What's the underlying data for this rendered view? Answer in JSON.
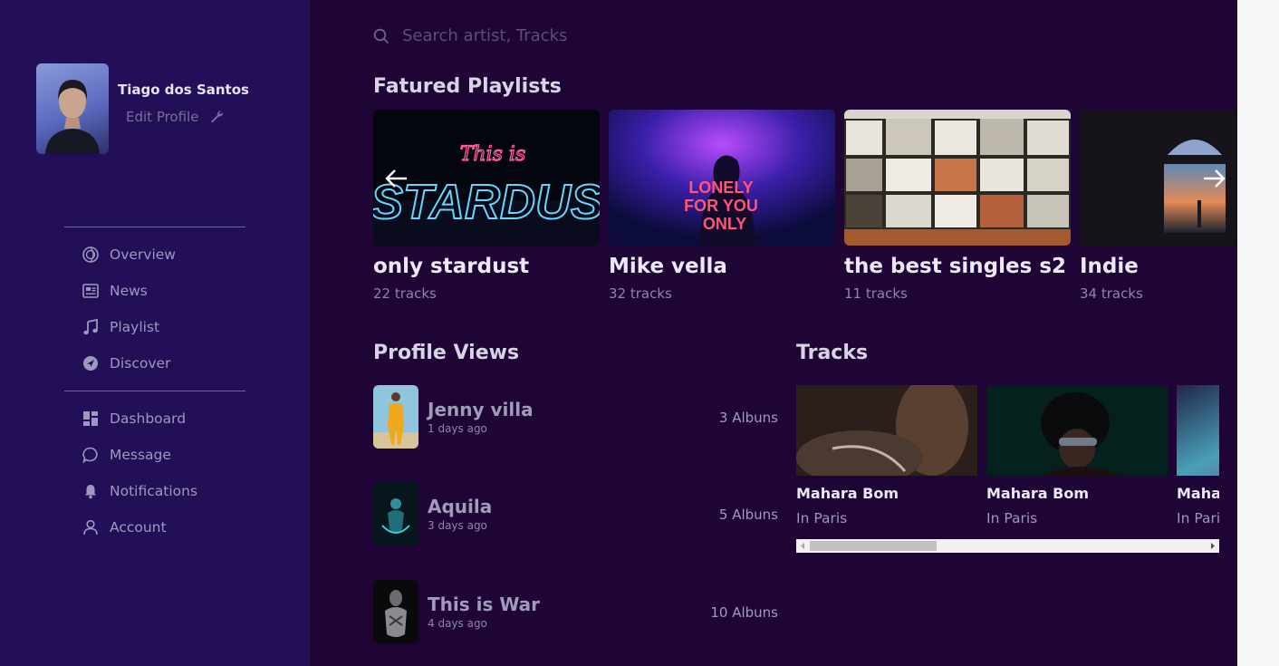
{
  "profile": {
    "name": "Tiago dos Santos",
    "edit_label": "Edit Profile"
  },
  "nav": {
    "group1": [
      {
        "label": "Overview",
        "icon": "overview-icon"
      },
      {
        "label": "News",
        "icon": "news-icon"
      },
      {
        "label": "Playlist",
        "icon": "music-note-icon"
      },
      {
        "label": "Discover",
        "icon": "compass-icon"
      }
    ],
    "group2": [
      {
        "label": "Dashboard",
        "icon": "dashboard-icon"
      },
      {
        "label": "Message",
        "icon": "message-icon"
      },
      {
        "label": "Notifications",
        "icon": "bell-icon"
      },
      {
        "label": "Account",
        "icon": "user-icon"
      }
    ]
  },
  "search": {
    "placeholder": "Search artist, Tracks"
  },
  "featured": {
    "title": "Fatured Playlists",
    "items": [
      {
        "name": "only stardust",
        "count": "22 tracks",
        "art_text_1": "This is",
        "art_text_2": "STARDUST"
      },
      {
        "name": "Mike vella",
        "count": "32 tracks",
        "art_text_1": "LONELY",
        "art_text_2": "FOR YOU",
        "art_text_3": "ONLY"
      },
      {
        "name": "the best singles s2",
        "count": "11 tracks"
      },
      {
        "name": "Indie",
        "count": "34 tracks"
      }
    ]
  },
  "profile_views": {
    "title": "Profile Views",
    "items": [
      {
        "name": "Jenny villa",
        "time": "1 days ago",
        "albums": "3 Albuns"
      },
      {
        "name": "Aquila",
        "time": "3 days ago",
        "albums": "5 Albuns"
      },
      {
        "name": "This is War",
        "time": "4 days ago",
        "albums": "10 Albuns"
      }
    ]
  },
  "tracks": {
    "title": "Tracks",
    "items": [
      {
        "title": "Mahara Bom",
        "subtitle": "In Paris"
      },
      {
        "title": "Mahara Bom",
        "subtitle": "In Paris"
      },
      {
        "title": "Mahara Bom",
        "subtitle": "In Paris"
      }
    ]
  },
  "colors": {
    "sidebar": "#220f57",
    "main": "#1f0535",
    "accent_pink": "#ff4d8d",
    "accent_blue": "#5fd0ff"
  }
}
